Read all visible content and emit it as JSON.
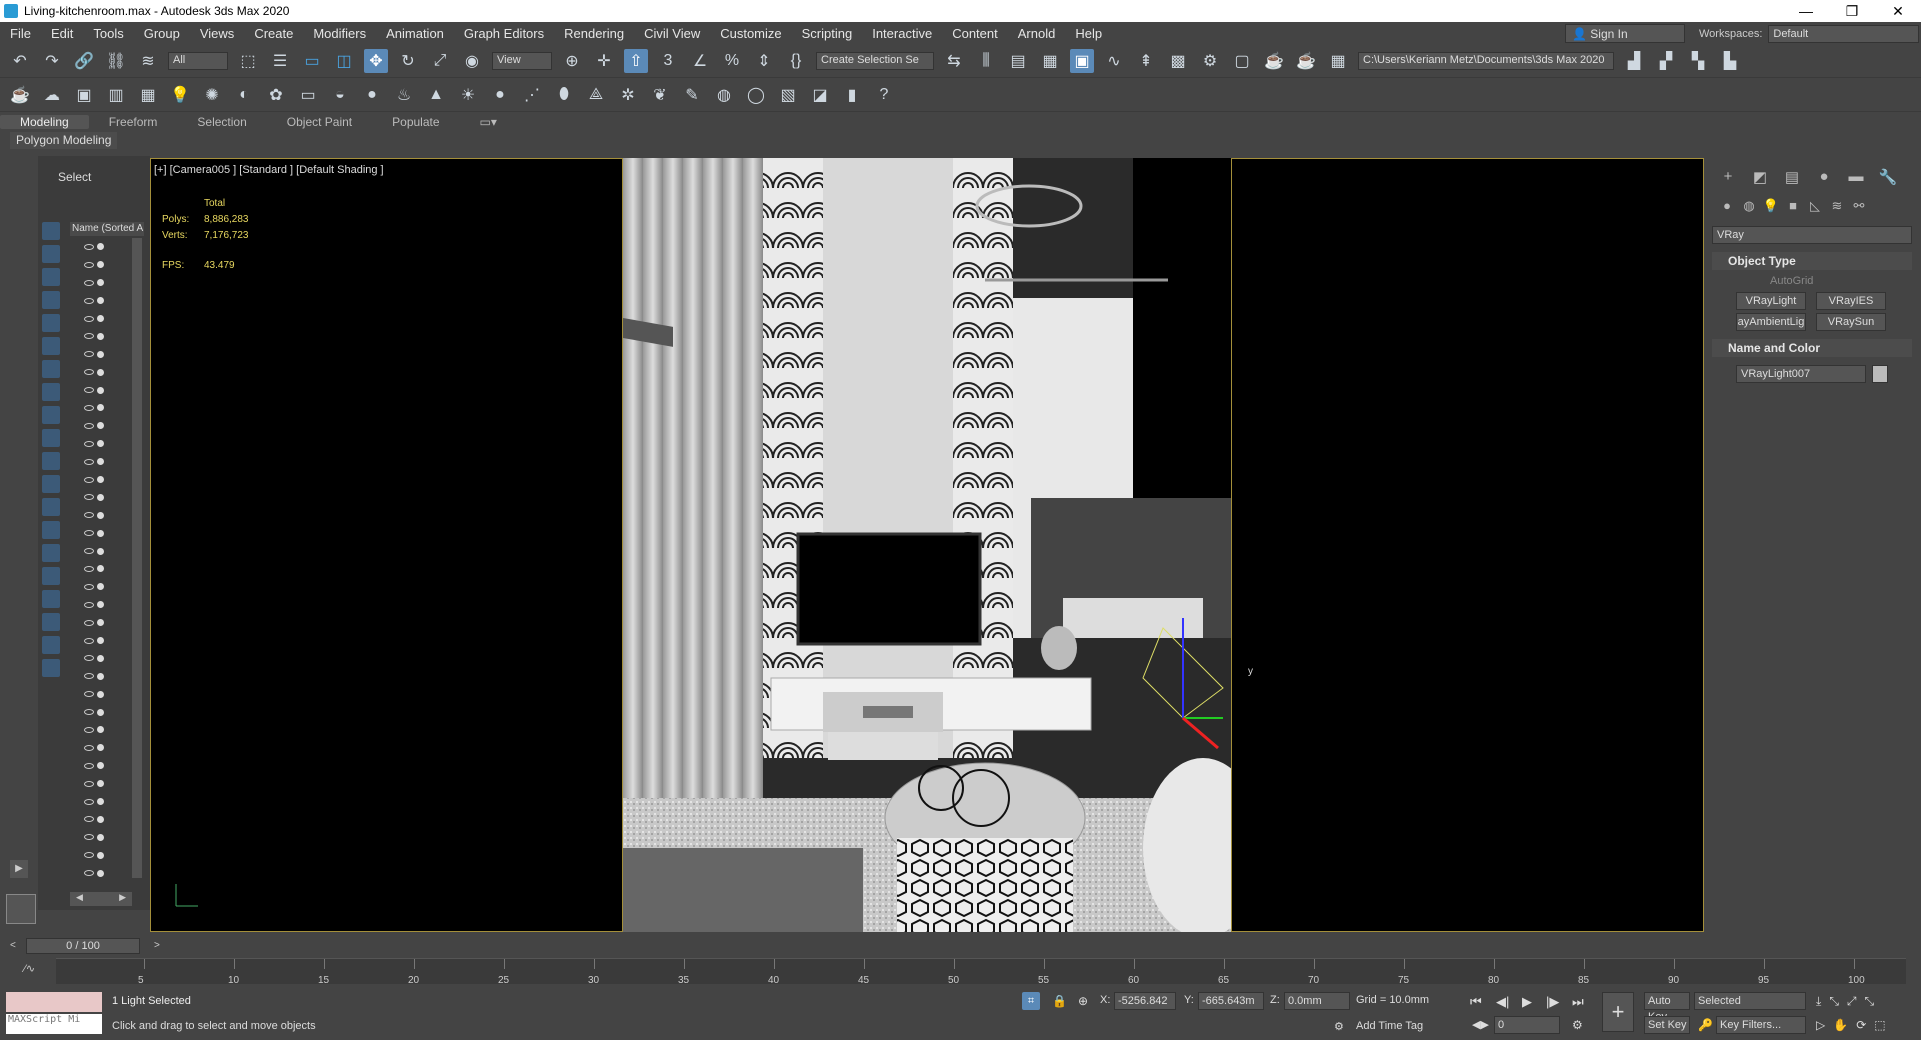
{
  "window": {
    "title": "Living-kitchenroom.max - Autodesk 3ds Max 2020",
    "minimize": "—",
    "restore": "❐",
    "close": "✕"
  },
  "menu": [
    "File",
    "Edit",
    "Tools",
    "Group",
    "Views",
    "Create",
    "Modifiers",
    "Animation",
    "Graph Editors",
    "Rendering",
    "Civil View",
    "Customize",
    "Scripting",
    "Interactive",
    "Content",
    "Arnold",
    "Help"
  ],
  "account": {
    "signin": "Sign In",
    "workspaces_label": "Workspaces:",
    "workspace_value": "Default"
  },
  "toolbar": {
    "filter": "All",
    "ref_coord": "View",
    "selection_set": "Create Selection Se",
    "project_path": "C:\\Users\\Keriann Metz\\Documents\\3ds Max 2020"
  },
  "ribbon": {
    "tabs": [
      "Modeling",
      "Freeform",
      "Selection",
      "Object Paint",
      "Populate"
    ],
    "panel": "Polygon Modeling"
  },
  "scene_explorer": {
    "select_tab": "Select",
    "name_header": "Name (Sorted A"
  },
  "viewport": {
    "label": "[+] [Camera005 ] [Standard ] [Default Shading ]",
    "stats": {
      "total_label": "Total",
      "polys_label": "Polys:",
      "polys": "8,886,283",
      "verts_label": "Verts:",
      "verts": "7,176,723",
      "fps_label": "FPS:",
      "fps": "43.479"
    },
    "axis_y": "y"
  },
  "command_panel": {
    "renderer": "VRay",
    "object_type_header": "Object Type",
    "autogrid": "AutoGrid",
    "buttons": [
      "VRayLight",
      "VRayIES",
      "ayAmbientLig",
      "VRaySun"
    ],
    "name_color_header": "Name and Color",
    "object_name": "VRayLight007",
    "swatch_color": "#bbbbbb"
  },
  "timeline": {
    "frame": "0 / 100",
    "ticks": [
      "5",
      "10",
      "15",
      "20",
      "25",
      "30",
      "35",
      "40",
      "45",
      "50",
      "55",
      "60",
      "65",
      "70",
      "75",
      "80",
      "85",
      "90",
      "95",
      "100"
    ]
  },
  "status": {
    "maxscript": "MAXScript Mi",
    "selected": "1 Light Selected",
    "prompt": "Click and drag to select and move objects",
    "x_label": "X:",
    "x": "-5256.842",
    "y_label": "Y:",
    "y": "-665.643m",
    "z_label": "Z:",
    "z": "0.0mm",
    "grid": "Grid = 10.0mm",
    "add_time_tag": "Add Time Tag",
    "auto_key": "Auto Key",
    "set_key": "Set Key",
    "key_mode": "Selected",
    "key_filters": "Key Filters...",
    "frame_field": "0"
  }
}
